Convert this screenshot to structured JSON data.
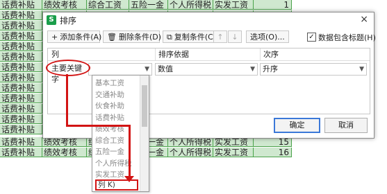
{
  "sheet": {
    "top_rows": [
      [
        "话费补贴",
        "绩效考核",
        "综合工资",
        "五险一金",
        "个人所得税",
        "实发工资",
        "1"
      ],
      [
        "话费补贴"
      ],
      [
        "话费补贴"
      ],
      [
        "话费补贴"
      ],
      [
        "话费补贴"
      ],
      [
        "话费补贴"
      ],
      [
        "话费补贴"
      ],
      [
        "话费补贴"
      ],
      [
        "话费补贴"
      ],
      [
        "话费补贴"
      ],
      [
        "话费补贴"
      ],
      [
        "话费补贴"
      ],
      [
        "话费补贴"
      ]
    ],
    "bottom_rows": [
      [
        "话费补贴",
        "绩效考核",
        "综合工资",
        "五险一金",
        "个人所得税",
        "实发工资",
        "15"
      ],
      [
        "话费补贴",
        "绩效考核",
        "综合工资",
        "五险一金",
        "个人所得税",
        "实发工资",
        "16"
      ]
    ]
  },
  "dialog": {
    "title": "排序",
    "close": "×",
    "toolbar": {
      "add": "添加条件(A)",
      "delete": "删除条件(D)",
      "copy": "复制条件(C)",
      "up": "↑",
      "down": "↓",
      "options": "选项(O)...",
      "header_checkbox_label": "数据包含标题(H)",
      "header_checked": "✓"
    },
    "columns": {
      "col": "列",
      "basis": "排序依据",
      "order": "次序"
    },
    "row": {
      "key_label": "主要关键字",
      "column_value": "",
      "basis_value": "数值",
      "order_value": "升序"
    },
    "ok": "确定",
    "cancel": "取消"
  },
  "dropdown": {
    "items": [
      "基本工资",
      "交通补助",
      "伙食补助",
      "话费补贴",
      "绩效考核",
      "综合工资",
      "五险一金",
      "个人所得税",
      "实发工资"
    ],
    "highlighted": "列 K)"
  },
  "colors": {
    "accent": "#d21414",
    "sheet_fill": "#cfe8cf",
    "grid_green": "#4aa24a"
  }
}
